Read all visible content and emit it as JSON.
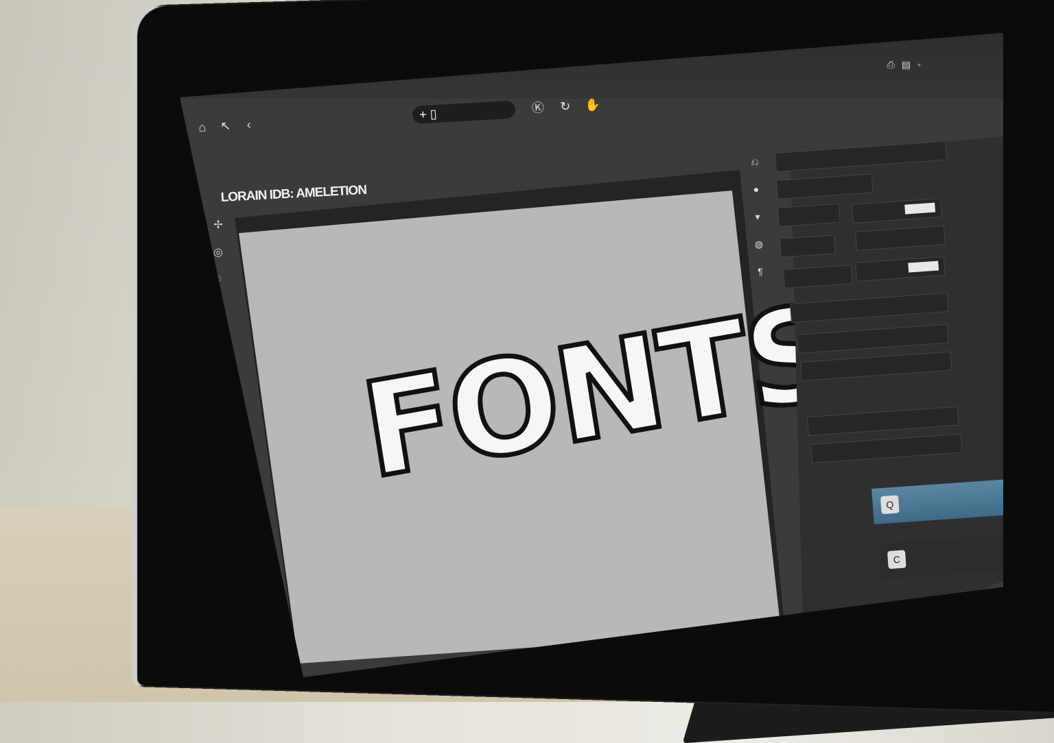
{
  "app": {
    "document_tab": "",
    "document_title": "LORAIN IDB: AMELETION",
    "menu_items": [
      "",
      "",
      "",
      "",
      "",
      "",
      "",
      ""
    ],
    "status_text": ""
  },
  "canvas": {
    "text": "FONTS"
  },
  "options_bar": {
    "tool_field": "+ ▯"
  },
  "panels": {
    "properties_title": "",
    "layers_title": "",
    "layer_selected": "",
    "layer_other": ""
  },
  "icons": {
    "add": "plus-icon",
    "text_tool": "text-tool-icon",
    "layer_thumb": "layer-thumbnail-icon",
    "trash": "trash-icon"
  },
  "colors": {
    "ui_dark": "#3b3b3b",
    "canvas": "#b7b9b9",
    "selection": "#4f7b99",
    "text_fill": "#f6f6f4",
    "text_stroke": "#111111"
  }
}
